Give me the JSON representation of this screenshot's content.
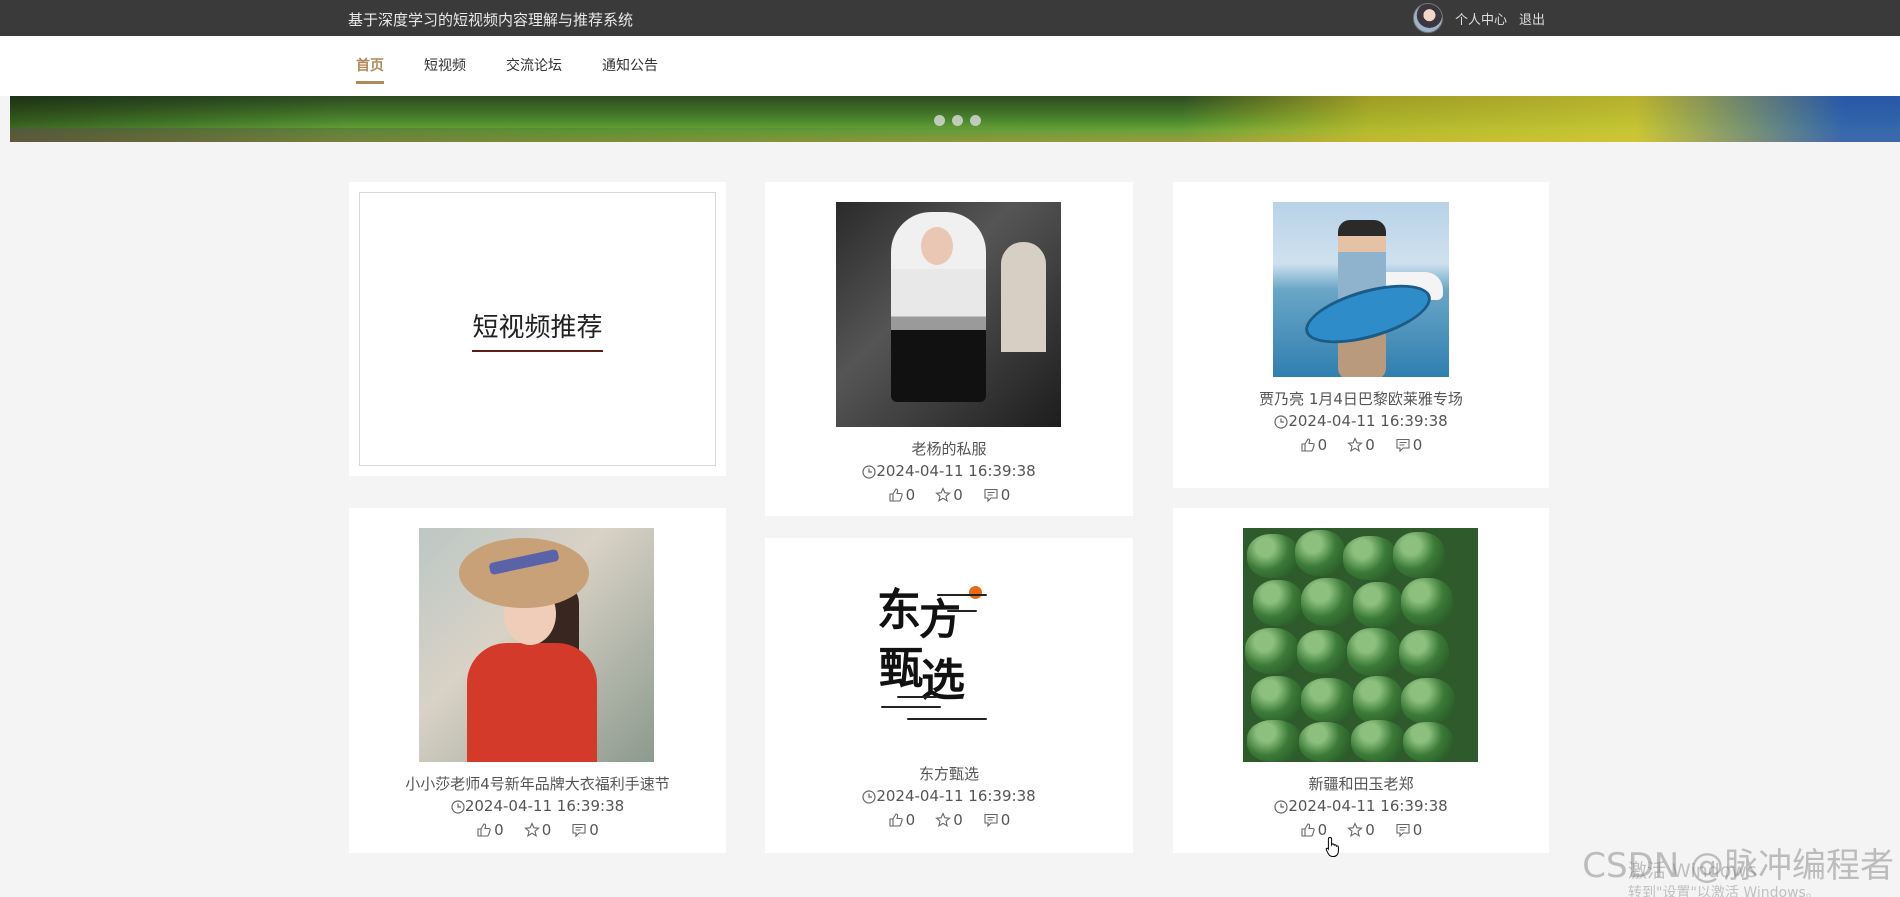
{
  "header": {
    "site_title": "基于深度学习的短视频内容理解与推荐系统",
    "user_center": "个人中心",
    "logout": "退出"
  },
  "nav": {
    "items": [
      {
        "label": "首页",
        "active": true
      },
      {
        "label": "短视频",
        "active": false
      },
      {
        "label": "交流论坛",
        "active": false
      },
      {
        "label": "通知公告",
        "active": false
      }
    ]
  },
  "banner": {
    "dot_count": 3
  },
  "intro": {
    "title": "短视频推荐"
  },
  "videos": [
    {
      "title": "老杨的私服",
      "time": "2024-04-11 16:39:38",
      "likes": "0",
      "favorites": "0",
      "comments": "0"
    },
    {
      "title": "贾乃亮 1月4日巴黎欧莱雅专场",
      "time": "2024-04-11 16:39:38",
      "likes": "0",
      "favorites": "0",
      "comments": "0"
    },
    {
      "title": "小小莎老师4号新年品牌大衣福利手速节",
      "time": "2024-04-11 16:39:38",
      "likes": "0",
      "favorites": "0",
      "comments": "0"
    },
    {
      "title": "东方甄选",
      "time": "2024-04-11 16:39:38",
      "likes": "0",
      "favorites": "0",
      "comments": "0"
    },
    {
      "title": "新疆和田玉老郑",
      "time": "2024-04-11 16:39:38",
      "likes": "0",
      "favorites": "0",
      "comments": "0"
    }
  ],
  "logo_chars": [
    "东",
    "方",
    "甄",
    "选"
  ],
  "overlays": {
    "watermark": "CSDN @脉冲编程者",
    "activate_title": "激活 Windows",
    "activate_sub": "转到\"设置\"以激活 Windows。"
  },
  "colors": {
    "topbar": "#3a3a3a",
    "accent": "#b08a5a",
    "background": "#f4f4f4",
    "logo_orange": "#e86a17"
  },
  "icons": [
    "avatar",
    "clock-icon",
    "thumbs-up-icon",
    "star-icon",
    "comment-icon",
    "hand-cursor-icon"
  ]
}
